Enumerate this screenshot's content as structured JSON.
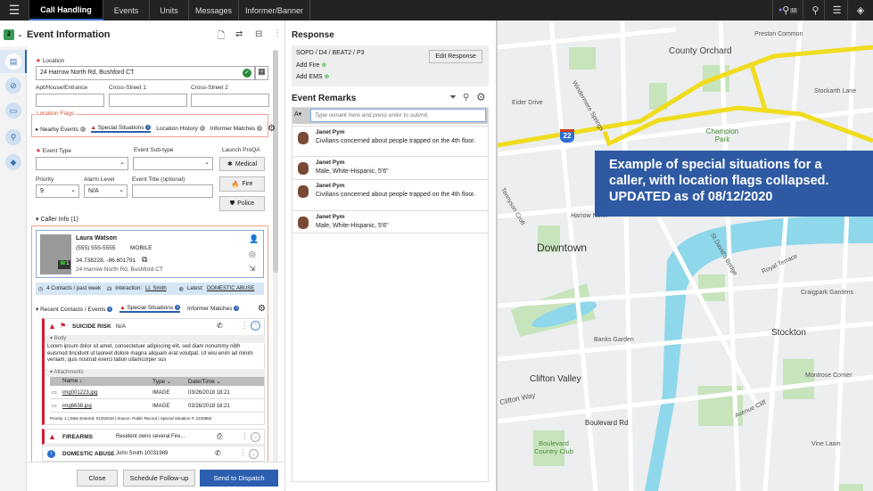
{
  "nav": {
    "tabs": [
      "Call Handling",
      "Events",
      "Units",
      "Messages",
      "Informer/Banner"
    ],
    "active": "Call Handling",
    "search_count": "12"
  },
  "event": {
    "badge": "2",
    "title": "Event Information",
    "location_label": "Location",
    "location_value": "24 Harrow North Rd, Bushford CT",
    "apt_label": "Apt/House/Entrance",
    "cross1_label": "Cross-Street 1",
    "cross2_label": "Cross-Street 2",
    "flags_label": "Location Flags",
    "flags": [
      {
        "label": "Nearby Events",
        "count": "0"
      },
      {
        "label": "Special Situations",
        "count": "2"
      },
      {
        "label": "Location History",
        "count": "0"
      },
      {
        "label": "Informer Matches",
        "count": "0"
      }
    ],
    "event_type_label": "Event Type",
    "event_subtype_label": "Event Sub-type",
    "proqa_label": "Launch ProQA",
    "priority_label": "Priority",
    "priority_value": "9",
    "alarm_label": "Alarm Level",
    "alarm_value": "N/A",
    "title_label": "Event Title (optional)",
    "medical": "Medical",
    "fire": "Fire",
    "police": "Police"
  },
  "caller": {
    "section": "Caller Info (1)",
    "name": "Laura Watson",
    "phone": "(555) 555-5555",
    "phone_type": "MOBILE",
    "coords": "34.738228, -86.601791",
    "address": "24 Harrow North Rd, Bushford CT",
    "line_count": "1",
    "contacts": "4 Contacts / past week",
    "interaction_label": "Interaction:",
    "interaction_value": "Lt. Smith",
    "latest_label": "Latest:",
    "latest_value": "DOMESTIC ABUSE"
  },
  "caller_tabs": [
    {
      "label": "Recent Contacts / Events",
      "count": "0"
    },
    {
      "label": "Special Situations",
      "count": "2"
    },
    {
      "label": "Informer Matches",
      "count": "0"
    }
  ],
  "situations": {
    "first": {
      "title": "SUICIDE RISK",
      "value": "N/A",
      "body_label": "Body",
      "body": "Lorem ipsum dolor sit amet, consectetuer adipiscing elit, sed diam nonummy nibh euismod tincidunt ut laoreet dolore magna aliquam erat volutpat. Ut wisi enim ad minim veniam, quis nostrud exerci tation ullamcorper sus",
      "attachments_label": "Attachments",
      "columns": [
        "Name",
        "Type",
        "Date/Time"
      ],
      "rows": [
        {
          "name": "img001223.jpg",
          "type": "IMAGE",
          "date": "03/26/2018 18:21"
        },
        {
          "name": "img6638.jpg",
          "type": "IMAGE",
          "date": "03/26/2018 18:21"
        }
      ],
      "footer": "Priority: 1 | Date Entered: 01202016 | Source: Public Record | Special Situation #: 2233893"
    },
    "second": {
      "title": "FIREARMS",
      "value": "Resident owns several Fire..."
    },
    "third": {
      "title": "DOMESTIC ABUSE",
      "value": "John Smith 10031989"
    }
  },
  "footer": {
    "close": "Close",
    "schedule": "Schedule Follow-up",
    "send": "Send to Dispatch"
  },
  "response": {
    "title": "Response",
    "route": "SOPD / D4 / BEAT2 / P3",
    "add_fire": "Add Fire",
    "add_ems": "Add EMS",
    "edit": "Edit Response"
  },
  "remarks": {
    "title": "Event Remarks",
    "placeholder": "Type remark here and press enter to submit.",
    "items": [
      {
        "author": "Janet Pym",
        "text": "Civilians concerned about people trapped on the 4th floor."
      },
      {
        "author": "Janet Pym",
        "text": "Male, White-Hispanic, 5'6\""
      },
      {
        "author": "Janet Pym",
        "text": "Civilians concerned about people trapped on the 4th floor."
      },
      {
        "author": "Janet Pym",
        "text": "Male, White-Hispanic, 5'6\""
      }
    ]
  },
  "map": {
    "banner": "Example of special situations for a caller, with location flags collapsed. UPDATED as of 08/12/2020",
    "shield": "22",
    "labels": [
      "Preston Common",
      "County Orchard",
      "Stockarth Lane",
      "Eider Drive",
      "Windermere Springs",
      "Champion Park",
      "Tennyson Croft",
      "Harrow North",
      "Downtown",
      "St David's Bridge",
      "Royal Terrace",
      "Craigpark Gardens",
      "Stockton",
      "Banks Garden",
      "Clifton Valley",
      "Clifton Way",
      "Montrose Corner",
      "Avenue Cliff",
      "Boulevard Rd",
      "Vine Lawn",
      "Boulevard Country Club"
    ]
  },
  "colors": {
    "accent": "#2d5fb0",
    "alert": "#d02030",
    "highway": "#f0dc1e",
    "water": "#8fd7ea",
    "park": "#c8e4bd"
  }
}
